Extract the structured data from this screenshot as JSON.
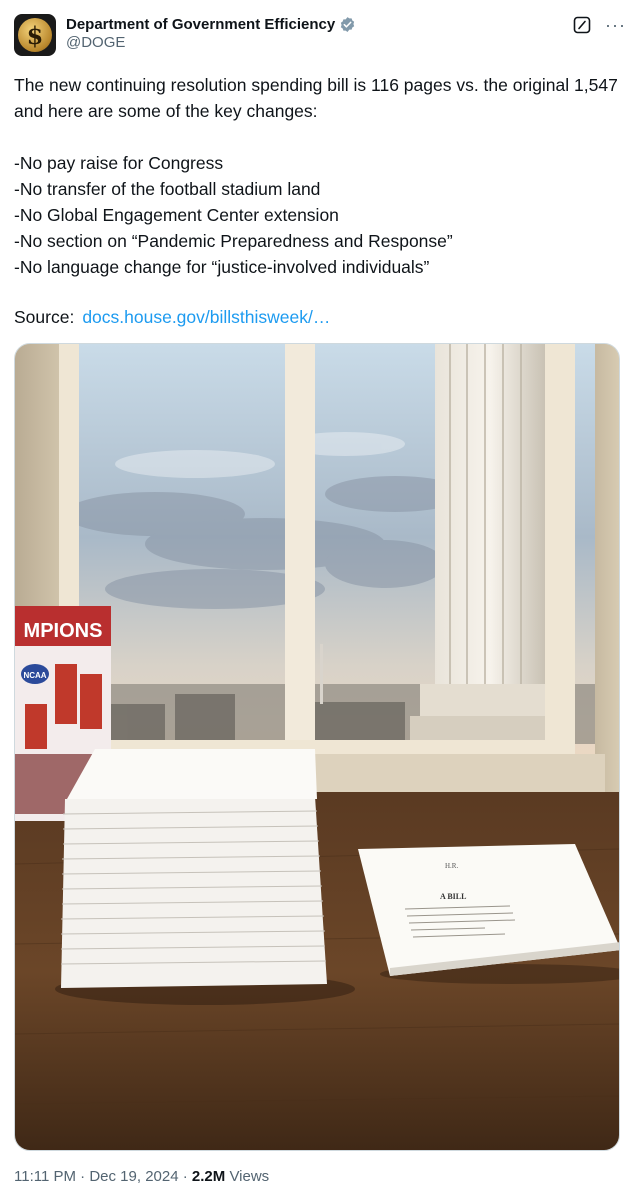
{
  "author": {
    "display_name": "Department of Government Efficiency",
    "handle": "@DOGE",
    "avatar_glyph": "$",
    "verified_color": "#829aab"
  },
  "tweet": {
    "text": "The new continuing resolution spending bill is 116 pages vs. the original 1,547 and here are some of the key changes:\n\n-No pay raise for Congress\n-No transfer of the football stadium land\n-No Global Engagement Center extension\n-No section on “Pandemic Preparedness and Response”\n-No language change for “justice-involved individuals”",
    "source_label": "Source:",
    "source_link": "docs.house.gov/billsthisweek/…",
    "link_color": "#1d9bf0"
  },
  "media": {
    "bill_title": "A BILL",
    "bill_header": "H.R.",
    "poster_title": "MPIONS",
    "poster_badge": "NCAA"
  },
  "meta": {
    "time": "11:11 PM",
    "separator": "·",
    "date": "Dec 19, 2024",
    "views_count": "2.2M",
    "views_label": "Views"
  },
  "icons": {
    "grok": "grok-icon",
    "more": "more-icon",
    "verified": "verified-badge-icon"
  }
}
